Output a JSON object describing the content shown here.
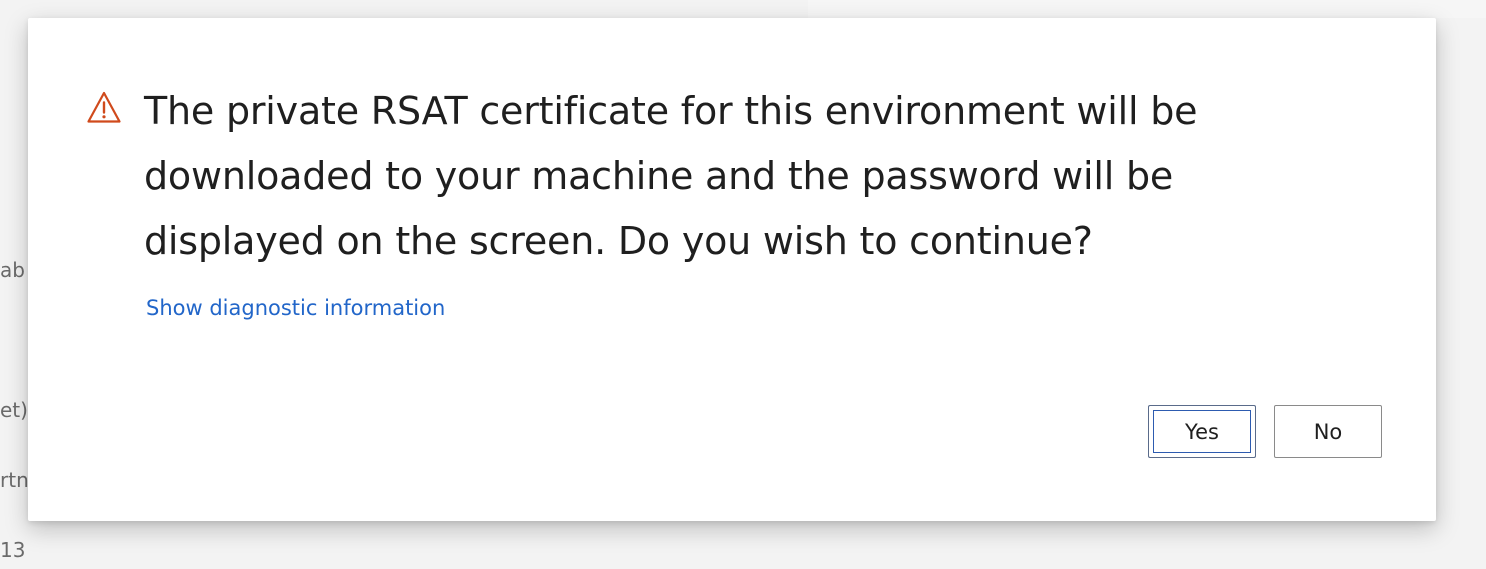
{
  "background": {
    "fragments": [
      "ab",
      "et)",
      "rtn",
      "13"
    ]
  },
  "dialog": {
    "icon": "warning-triangle-icon",
    "message": "The private RSAT certificate for this environment will be downloaded to your machine and the password will be displayed on the screen. Do you wish to continue?",
    "diagnostic_link": "Show diagnostic information",
    "buttons": {
      "yes": "Yes",
      "no": "No"
    }
  },
  "colors": {
    "warning": "#d04a1c",
    "link": "#2266c9",
    "focus": "#2d5bb0"
  }
}
